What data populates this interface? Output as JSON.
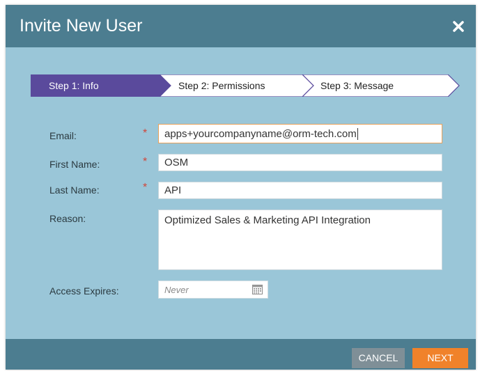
{
  "dialog": {
    "title": "Invite New User",
    "close_icon": "close-icon"
  },
  "steps": [
    {
      "label": "Step 1: Info",
      "active": true
    },
    {
      "label": "Step 2: Permissions",
      "active": false
    },
    {
      "label": "Step 3: Message",
      "active": false
    }
  ],
  "form": {
    "email": {
      "label": "Email:",
      "value": "apps+yourcompanyname@orm-tech.com",
      "required": true
    },
    "first_name": {
      "label": "First Name:",
      "value": "OSM",
      "required": true
    },
    "last_name": {
      "label": "Last Name:",
      "value": "API",
      "required": true
    },
    "reason": {
      "label": "Reason:",
      "value": "Optimized Sales & Marketing API Integration"
    },
    "access_expires": {
      "label": "Access Expires:",
      "placeholder": "Never",
      "icon": "calendar-icon"
    },
    "required_marker": "*"
  },
  "footer": {
    "cancel_label": "CANCEL",
    "next_label": "NEXT"
  },
  "colors": {
    "title_bar": "#4c7d90",
    "body": "#9ac6d8",
    "active_step": "#5a4a9c",
    "next_button": "#f0822a",
    "cancel_button": "#7f8f97",
    "required": "#d0463a"
  }
}
